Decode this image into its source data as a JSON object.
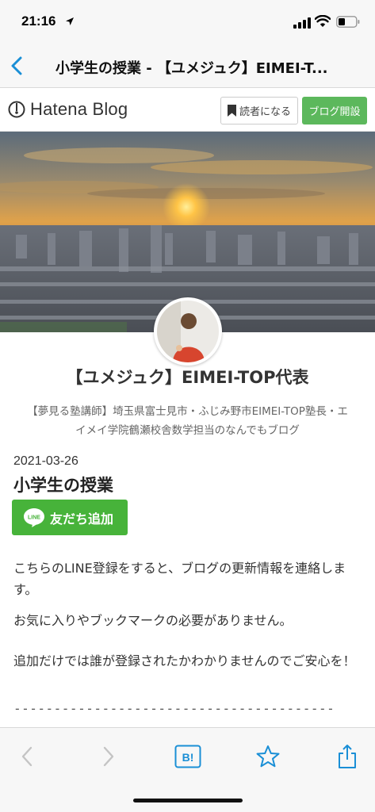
{
  "status_bar": {
    "time": "21:16"
  },
  "nav": {
    "title": "小学生の授業 - 【ユメジュク】EIMEI-T..."
  },
  "hatena": {
    "logo_text": "Hatena Blog",
    "reader_button": "読者になる",
    "open_blog_button": "ブログ開設"
  },
  "blog": {
    "title": "【ユメジュク】EIMEI-TOP代表",
    "description": "【夢見る塾講師】埼玉県富士見市・ふじみ野市EIMEI-TOP塾長・エイメイ学院鶴瀬校舎数学担当のなんでもブログ"
  },
  "post": {
    "date": "2021-03-26",
    "title": "小学生の授業",
    "line_button": "友だち追加",
    "line_logo_text": "LINE",
    "paragraphs": [
      "こちらのLINE登録をすると、ブログの更新情報を連絡します。",
      "お気に入りやブックマークの必要がありません。",
      "追加だけでは誰が登録されたかわかりませんのでご安心を！"
    ],
    "divider": "----------------------------------------"
  },
  "toolbar": {
    "back_icon": "chevron-left-icon",
    "forward_icon": "chevron-right-icon",
    "hatebu_label": "B!",
    "bookmark_icon": "star-icon",
    "share_icon": "share-icon"
  },
  "colors": {
    "accent_blue": "#1a8fd6",
    "hatena_green": "#5cb85c",
    "line_green": "#47b33a"
  }
}
